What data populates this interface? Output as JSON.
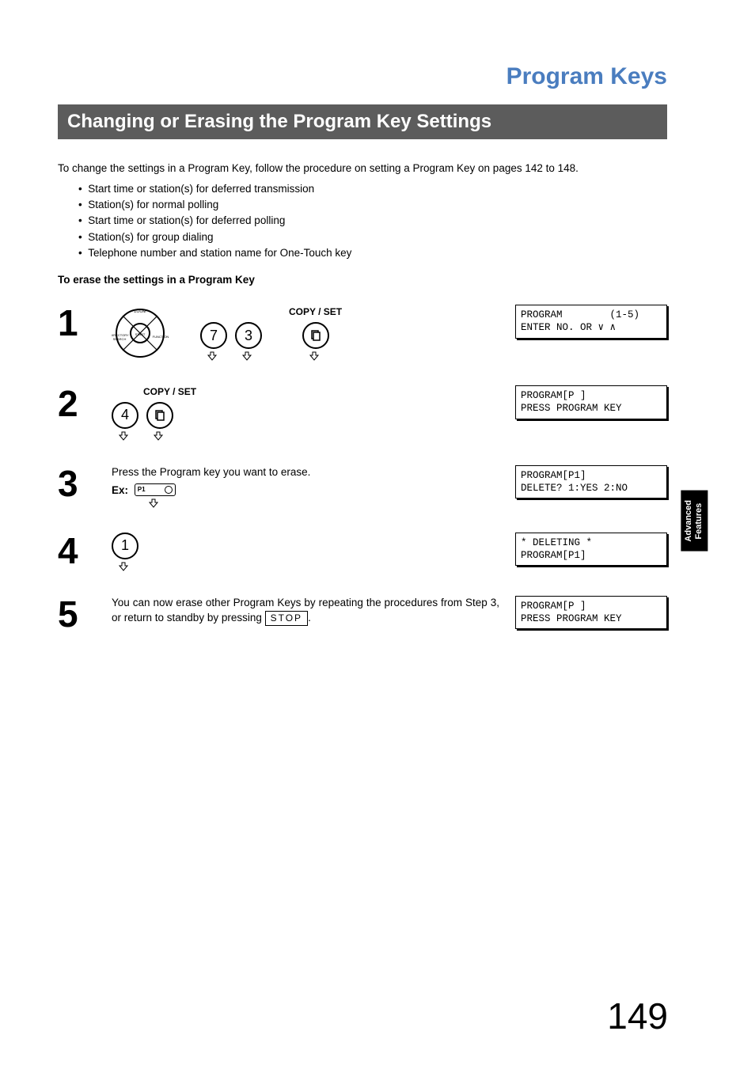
{
  "title": "Program Keys",
  "section_heading": "Changing or Erasing the Program Key Settings",
  "intro": "To change the settings in a Program Key, follow the procedure on setting a Program Key on pages 142 to 148.",
  "bullets": [
    "Start time or station(s) for deferred transmission",
    "Station(s) for normal polling",
    "Start time or station(s) for deferred polling",
    "Station(s) for group dialing",
    "Telephone number and station name for One-Touch key"
  ],
  "subheading": "To erase the settings in a Program Key",
  "copy_set_label": "COPY / SET",
  "keys": {
    "k7": "7",
    "k3": "3",
    "k4": "4",
    "k1": "1"
  },
  "steps": {
    "s1": {
      "num": "1",
      "lcd_l1": "PROGRAM        (1-5)",
      "lcd_l2": "ENTER NO. OR ∨ ∧"
    },
    "s2": {
      "num": "2",
      "lcd_l1": "PROGRAM[P ]",
      "lcd_l2": "PRESS PROGRAM KEY"
    },
    "s3": {
      "num": "3",
      "text": "Press the Program key you want to erase.",
      "ex_label": "Ex:",
      "p1_key": "P1",
      "lcd_l1": "PROGRAM[P1]",
      "lcd_l2": "DELETE? 1:YES 2:NO"
    },
    "s4": {
      "num": "4",
      "lcd_l1": "* DELETING *",
      "lcd_l2": "PROGRAM[P1]"
    },
    "s5": {
      "num": "5",
      "text_a": "You can now erase other Program Keys by repeating the procedures from Step 3, or return to standby by pressing ",
      "stop_label": "STOP",
      "text_b": ".",
      "lcd_l1": "PROGRAM[P ]",
      "lcd_l2": "PRESS PROGRAM KEY"
    }
  },
  "side_tab_l1": "Advanced",
  "side_tab_l2": "Features",
  "page_number": "149"
}
